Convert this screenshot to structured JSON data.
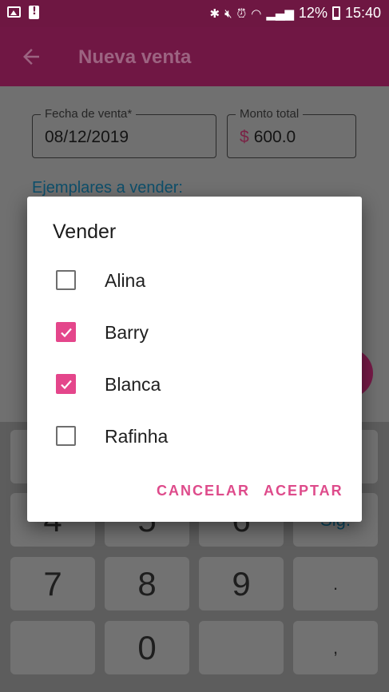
{
  "status_bar": {
    "percent": "12%",
    "time": "15:40"
  },
  "app_bar": {
    "title": "Nueva venta"
  },
  "form": {
    "date_field": {
      "label": "Fecha de venta*",
      "value": "08/12/2019"
    },
    "amount_field": {
      "label": "Monto total",
      "currency_symbol": "$",
      "value": "600.0"
    },
    "section_label": "Ejemplares a vender:"
  },
  "keyboard": {
    "keys": [
      "4",
      "5",
      "6",
      "Sig.",
      "7",
      "8",
      "9",
      ".",
      "0",
      ","
    ]
  },
  "dialog": {
    "title": "Vender",
    "options": [
      {
        "label": "Alina",
        "checked": false
      },
      {
        "label": "Barry",
        "checked": true
      },
      {
        "label": "Blanca",
        "checked": true
      },
      {
        "label": "Rafinha",
        "checked": false
      }
    ],
    "cancel_label": "CANCELAR",
    "accept_label": "ACEPTAR"
  },
  "colors": {
    "accent": "#e4468b",
    "primary_dimmed": "#701744",
    "scrim": "#707070"
  }
}
